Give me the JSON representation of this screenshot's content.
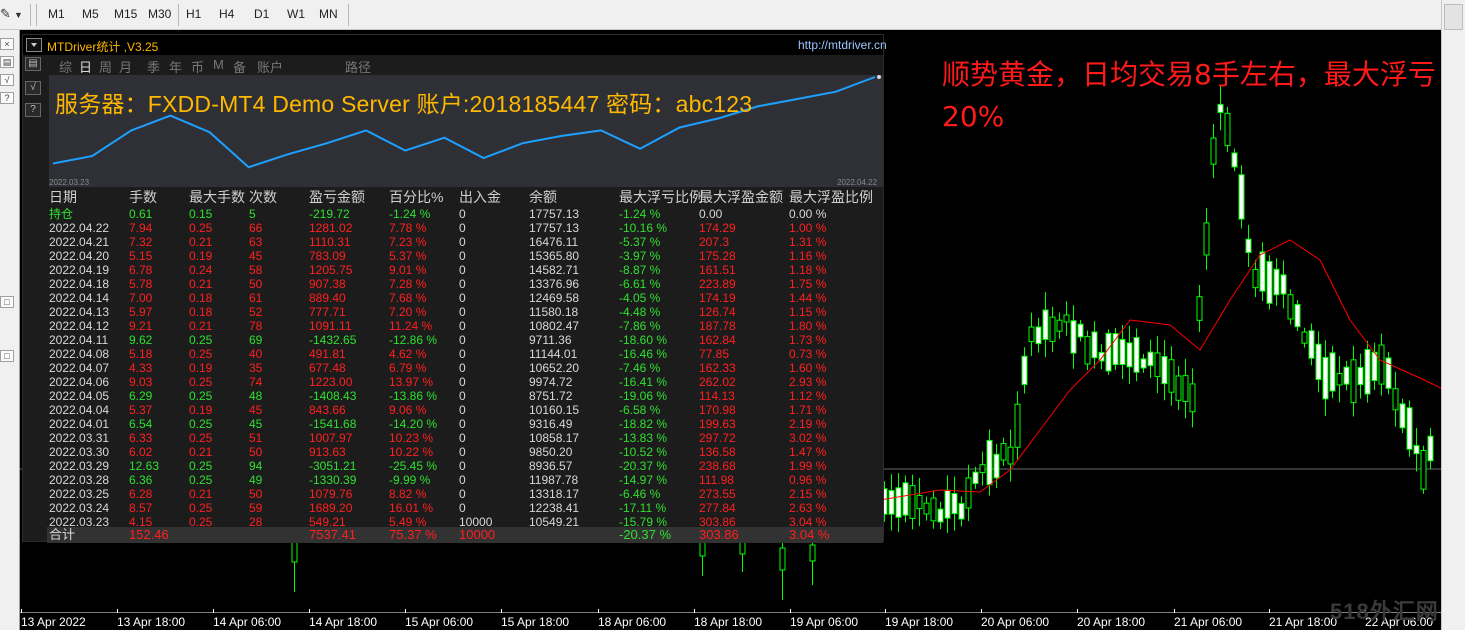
{
  "timeframes": [
    "M1",
    "M5",
    "M15",
    "M30",
    "H1",
    "H4",
    "D1",
    "W1",
    "MN"
  ],
  "left_buttons": [
    "▤",
    "√",
    "?"
  ],
  "panel": {
    "title": "MTDriver统计 ,V3.25",
    "url": "http://mtdriver.cn",
    "tabs": [
      "综",
      "日",
      "周",
      "月",
      "季",
      "年",
      "币",
      "M",
      "备",
      "账户",
      "路径"
    ],
    "server_info": "服务器：FXDD-MT4 Demo Server  账户:2018185447 密码：abc123",
    "equity_curve": [
      0.06,
      0.14,
      0.42,
      0.58,
      0.4,
      0.02,
      0.16,
      0.28,
      0.42,
      0.2,
      0.34,
      0.12,
      0.28,
      0.36,
      0.42,
      0.22,
      0.45,
      0.55,
      0.68,
      0.76,
      0.84,
      1.0
    ],
    "date_start": "2022.03.23",
    "date_end": "2022.04.22",
    "columns": [
      "日期",
      "手数",
      "最大手数",
      "次数",
      "盈亏金额",
      "百分比%",
      "出入金",
      "余额",
      "最大浮亏比例",
      "最大浮盈金额",
      "最大浮盈比例"
    ],
    "rows": [
      {
        "c": "g",
        "v": [
          "持仓",
          "0.61",
          "0.15",
          "5",
          "-219.72",
          "-1.24 %",
          "0",
          "17757.13",
          "-1.24 %",
          "0.00",
          "0.00 %"
        ]
      },
      {
        "c": "r",
        "v": [
          "2022.04.22",
          "7.94",
          "0.25",
          "66",
          "1281.02",
          "7.78 %",
          "0",
          "17757.13",
          "-10.16 %",
          "174.29",
          "1.00 %"
        ]
      },
      {
        "c": "r",
        "v": [
          "2022.04.21",
          "7.32",
          "0.21",
          "63",
          "1110.31",
          "7.23 %",
          "0",
          "16476.11",
          "-5.37 %",
          "207.3",
          "1.31 %"
        ]
      },
      {
        "c": "r",
        "v": [
          "2022.04.20",
          "5.15",
          "0.19",
          "45",
          "783.09",
          "5.37 %",
          "0",
          "15365.80",
          "-3.97 %",
          "175.28",
          "1.16 %"
        ]
      },
      {
        "c": "r",
        "v": [
          "2022.04.19",
          "6.78",
          "0.24",
          "58",
          "1205.75",
          "9.01 %",
          "0",
          "14582.71",
          "-8.87 %",
          "161.51",
          "1.18 %"
        ]
      },
      {
        "c": "r",
        "v": [
          "2022.04.18",
          "5.78",
          "0.21",
          "50",
          "907.38",
          "7.28 %",
          "0",
          "13376.96",
          "-6.61 %",
          "223.89",
          "1.75 %"
        ]
      },
      {
        "c": "r",
        "v": [
          "2022.04.14",
          "7.00",
          "0.18",
          "61",
          "889.40",
          "7.68 %",
          "0",
          "12469.58",
          "-4.05 %",
          "174.19",
          "1.44 %"
        ]
      },
      {
        "c": "r",
        "v": [
          "2022.04.13",
          "5.97",
          "0.18",
          "52",
          "777.71",
          "7.20 %",
          "0",
          "11580.18",
          "-4.48 %",
          "126.74",
          "1.15 %"
        ]
      },
      {
        "c": "r",
        "v": [
          "2022.04.12",
          "9.21",
          "0.21",
          "78",
          "1091.11",
          "11.24 %",
          "0",
          "10802.47",
          "-7.86 %",
          "187.78",
          "1.80 %"
        ]
      },
      {
        "c": "g",
        "v": [
          "2022.04.11",
          "9.62",
          "0.25",
          "69",
          "-1432.65",
          "-12.86 %",
          "0",
          "9711.36",
          "-18.60 %",
          "162.84",
          "1.73 %"
        ]
      },
      {
        "c": "r",
        "v": [
          "2022.04.08",
          "5.18",
          "0.25",
          "40",
          "491.81",
          "4.62 %",
          "0",
          "11144.01",
          "-16.46 %",
          "77.85",
          "0.73 %"
        ]
      },
      {
        "c": "r",
        "v": [
          "2022.04.07",
          "4.33",
          "0.19",
          "35",
          "677.48",
          "6.79 %",
          "0",
          "10652.20",
          "-7.46 %",
          "162.33",
          "1.60 %"
        ]
      },
      {
        "c": "r",
        "v": [
          "2022.04.06",
          "9.03",
          "0.25",
          "74",
          "1223.00",
          "13.97 %",
          "0",
          "9974.72",
          "-16.41 %",
          "262.02",
          "2.93 %"
        ]
      },
      {
        "c": "g",
        "v": [
          "2022.04.05",
          "6.29",
          "0.25",
          "48",
          "-1408.43",
          "-13.86 %",
          "0",
          "8751.72",
          "-19.06 %",
          "114.13",
          "1.12 %"
        ]
      },
      {
        "c": "r",
        "v": [
          "2022.04.04",
          "5.37",
          "0.19",
          "45",
          "843.66",
          "9.06 %",
          "0",
          "10160.15",
          "-6.58 %",
          "170.98",
          "1.71 %"
        ]
      },
      {
        "c": "g",
        "v": [
          "2022.04.01",
          "6.54",
          "0.25",
          "45",
          "-1541.68",
          "-14.20 %",
          "0",
          "9316.49",
          "-18.82 %",
          "199.63",
          "2.19 %"
        ]
      },
      {
        "c": "r",
        "v": [
          "2022.03.31",
          "6.33",
          "0.25",
          "51",
          "1007.97",
          "10.23 %",
          "0",
          "10858.17",
          "-13.83 %",
          "297.72",
          "3.02 %"
        ]
      },
      {
        "c": "r",
        "v": [
          "2022.03.30",
          "6.02",
          "0.21",
          "50",
          "913.63",
          "10.22 %",
          "0",
          "9850.20",
          "-10.52 %",
          "136.58",
          "1.47 %"
        ]
      },
      {
        "c": "g",
        "v": [
          "2022.03.29",
          "12.63",
          "0.25",
          "94",
          "-3051.21",
          "-25.45 %",
          "0",
          "8936.57",
          "-20.37 %",
          "238.68",
          "1.99 %"
        ]
      },
      {
        "c": "g",
        "v": [
          "2022.03.28",
          "6.36",
          "0.25",
          "49",
          "-1330.39",
          "-9.99 %",
          "0",
          "11987.78",
          "-14.97 %",
          "111.98",
          "0.96 %"
        ]
      },
      {
        "c": "r",
        "v": [
          "2022.03.25",
          "6.28",
          "0.21",
          "50",
          "1079.76",
          "8.82 %",
          "0",
          "13318.17",
          "-6.46 %",
          "273.55",
          "2.15 %"
        ]
      },
      {
        "c": "r",
        "v": [
          "2022.03.24",
          "8.57",
          "0.25",
          "59",
          "1689.20",
          "16.01 %",
          "0",
          "12238.41",
          "-17.11 %",
          "277.84",
          "2.63 %"
        ]
      },
      {
        "c": "r",
        "v": [
          "2022.03.23",
          "4.15",
          "0.25",
          "28",
          "549.21",
          "5.49 %",
          "10000",
          "10549.21",
          "-15.79 %",
          "303.86",
          "3.04 %"
        ]
      }
    ],
    "total": {
      "label": "合计",
      "lots": "152.46",
      "profit": "7537.41",
      "percent": "75.37 %",
      "deposit": "10000",
      "max_dd": "-20.37 %",
      "max_float": "303.86",
      "max_float_pct": "3.04 %"
    }
  },
  "annotation": "顺势黄金，日均交易8手左右，最大浮亏20%",
  "x_axis": [
    "13 Apr 2022",
    "13 Apr 18:00",
    "14 Apr 06:00",
    "14 Apr 18:00",
    "15 Apr 06:00",
    "15 Apr 18:00",
    "18 Apr 06:00",
    "18 Apr 18:00",
    "19 Apr 06:00",
    "19 Apr 18:00",
    "20 Apr 06:00",
    "20 Apr 18:00",
    "21 Apr 06:00",
    "21 Apr 18:00",
    "22 Apr 06:00"
  ],
  "watermark": "518外汇网",
  "colors": {
    "bull": "#000000",
    "bear": "#ffffff",
    "candle_outline": "#00ff00",
    "ma": "#ff0000",
    "equity": "#1ea0ff",
    "title": "#ffb800"
  }
}
